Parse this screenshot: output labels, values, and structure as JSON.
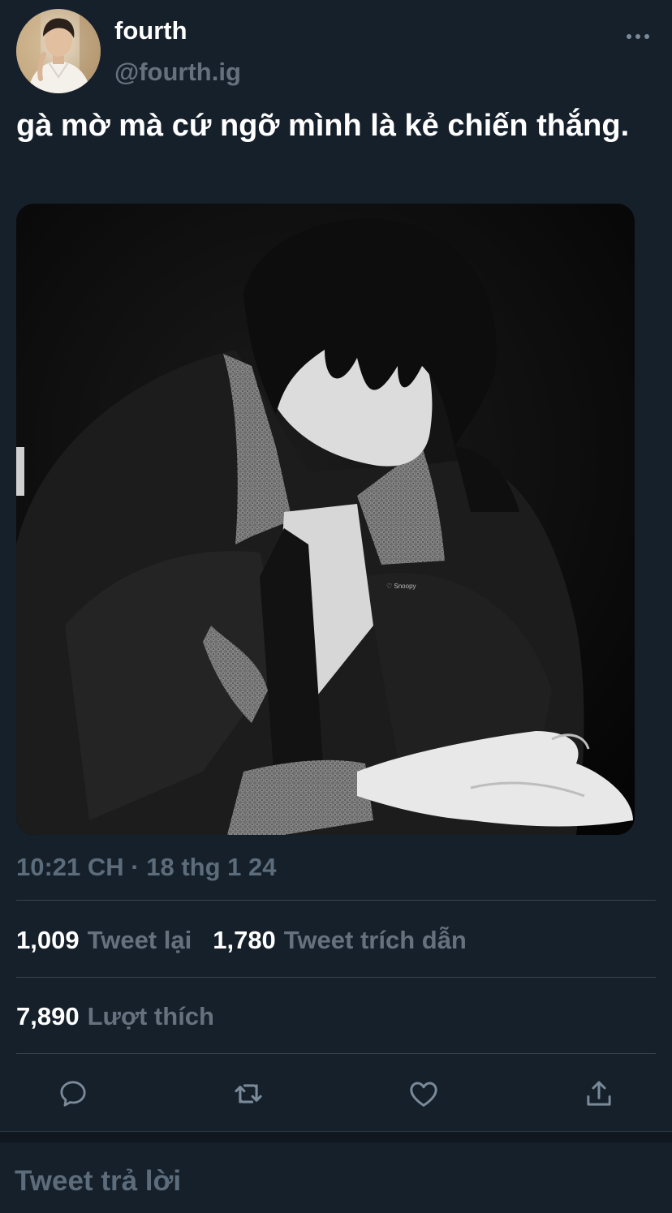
{
  "user": {
    "display_name": "fourth",
    "handle": "@fourth.ig"
  },
  "tweet": {
    "text": "gà mờ mà cứ ngỡ mình là kẻ chiến thắng.",
    "timestamp": "10:21 CH · 18 thg 1 24",
    "photo_watermark": "♡ Snoopy"
  },
  "stats": {
    "retweets": {
      "count": "1,009",
      "label": "Tweet lại"
    },
    "quotes": {
      "count": "1,780",
      "label": "Tweet trích dẫn"
    },
    "likes": {
      "count": "7,890",
      "label": "Lượt thích"
    }
  },
  "actions": [
    "reply-icon",
    "retweet-icon",
    "heart-icon",
    "share-icon"
  ],
  "reply": {
    "placeholder": "Tweet trả lời"
  },
  "colors": {
    "background": "#15202b",
    "divider": "#38444d",
    "muted_text": "#66717d",
    "icon": "#7a8a99"
  }
}
